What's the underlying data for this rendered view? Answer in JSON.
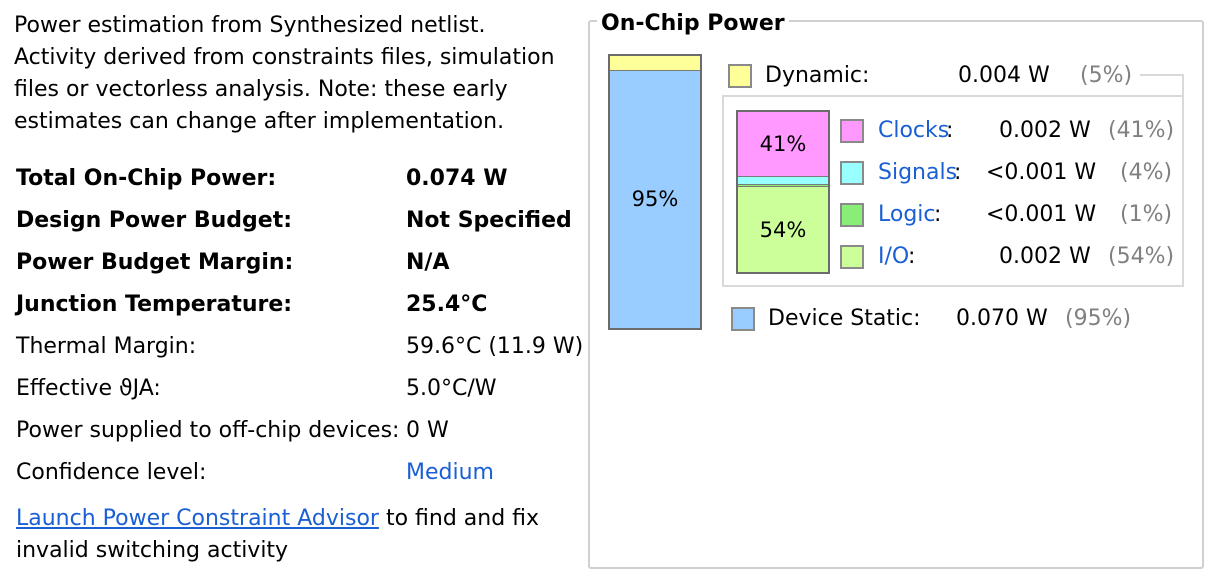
{
  "description": "Power estimation from Synthesized netlist. Activity derived from constraints files, simulation files or vectorless analysis. Note: these early estimates can change after implementation.",
  "summary": [
    {
      "label": "Total On-Chip Power:",
      "value": "0.074 W",
      "bold": true
    },
    {
      "label": "Design Power Budget:",
      "value": "Not Specified",
      "bold": true
    },
    {
      "label": "Power Budget Margin:",
      "value": "N/A",
      "bold": true
    },
    {
      "label": "Junction Temperature:",
      "value": "25.4°C",
      "bold": true
    },
    {
      "label": "Thermal Margin:",
      "value": "59.6°C (11.9 W)",
      "bold": false
    },
    {
      "label": "Effective ϑJA:",
      "value": "5.0°C/W",
      "bold": false
    },
    {
      "label": "Power supplied to off-chip devices:",
      "value": "0 W",
      "bold": false
    },
    {
      "label": "Confidence level:",
      "value": "Medium",
      "bold": false,
      "link": true
    }
  ],
  "advisor": {
    "link_text": "Launch Power Constraint Advisor",
    "rest": " to find and fix invalid switching activity"
  },
  "panel": {
    "title": "On-Chip Power",
    "main_bar": [
      {
        "name": "Dynamic",
        "fraction": 0.05,
        "color": "#ffff99",
        "label": ""
      },
      {
        "name": "Device Static",
        "fraction": 0.95,
        "color": "#99ccff",
        "label": "95%"
      }
    ],
    "sub_bar": [
      {
        "name": "Clocks",
        "fraction": 0.41,
        "color": "#ff99ff",
        "label": "41%"
      },
      {
        "name": "Signals",
        "fraction": 0.04,
        "color": "#99ffff",
        "label": ""
      },
      {
        "name": "Logic",
        "fraction": 0.01,
        "color": "#88ee77",
        "label": ""
      },
      {
        "name": "I/O",
        "fraction": 0.54,
        "color": "#ccff99",
        "label": "54%"
      }
    ],
    "dynamic": {
      "label": "Dynamic:",
      "value": "0.004 W",
      "pct": "(5%)",
      "color": "#ffff99"
    },
    "items": [
      {
        "label": "Clocks",
        "value": "0.002 W",
        "pct": "(41%)",
        "color": "#ff99ff"
      },
      {
        "label": "Signals",
        "value": "<0.001 W",
        "pct": "(4%)",
        "color": "#99ffff"
      },
      {
        "label": "Logic",
        "value": "<0.001 W",
        "pct": "(1%)",
        "color": "#88ee77"
      },
      {
        "label": "I/O",
        "value": "0.002 W",
        "pct": "(54%)",
        "color": "#ccff99"
      }
    ],
    "static": {
      "label": "Device Static:",
      "value": "0.070 W",
      "pct": "(95%)",
      "color": "#99ccff"
    }
  }
}
